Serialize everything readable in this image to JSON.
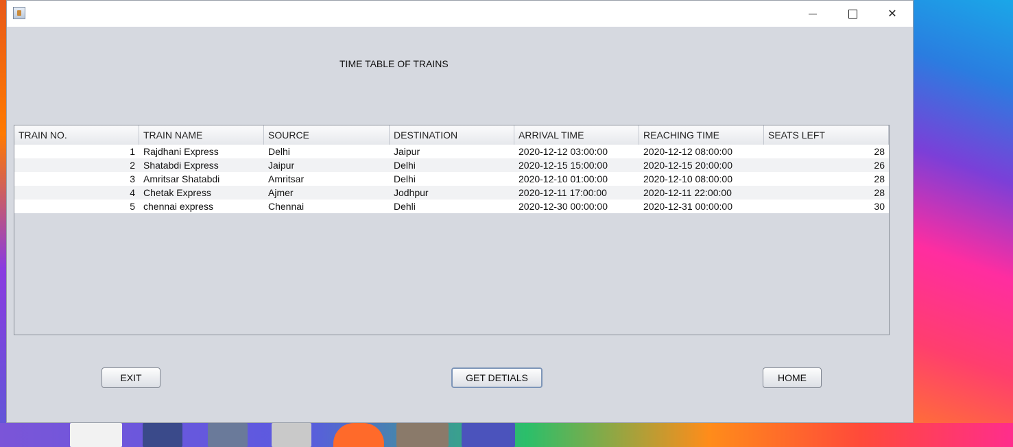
{
  "window": {
    "heading": "TIME TABLE OF TRAINS",
    "controls": {
      "minimize": "—",
      "maximize": "□",
      "close": "✕"
    }
  },
  "table": {
    "columns": [
      "TRAIN NO.",
      "TRAIN NAME",
      "SOURCE",
      "DESTINATION",
      "ARRIVAL TIME",
      "REACHING TIME",
      "SEATS LEFT"
    ],
    "rows": [
      [
        "1",
        "Rajdhani Express",
        "Delhi",
        "Jaipur",
        "2020-12-12 03:00:00",
        "2020-12-12 08:00:00",
        "28"
      ],
      [
        "2",
        "Shatabdi Express",
        "Jaipur",
        "Delhi",
        "2020-12-15 15:00:00",
        "2020-12-15 20:00:00",
        "26"
      ],
      [
        "3",
        "Amritsar Shatabdi",
        "Amritsar",
        "Delhi",
        "2020-12-10 01:00:00",
        "2020-12-10 08:00:00",
        "28"
      ],
      [
        "4",
        "Chetak Express",
        "Ajmer",
        "Jodhpur",
        "2020-12-11 17:00:00",
        "2020-12-11 22:00:00",
        "28"
      ],
      [
        "5",
        "chennai express",
        "Chennai",
        "Dehli",
        "2020-12-30 00:00:00",
        "2020-12-31 00:00:00",
        "30"
      ]
    ]
  },
  "buttons": {
    "exit": "EXIT",
    "get_details": "GET DETIALS",
    "home": "HOME"
  }
}
